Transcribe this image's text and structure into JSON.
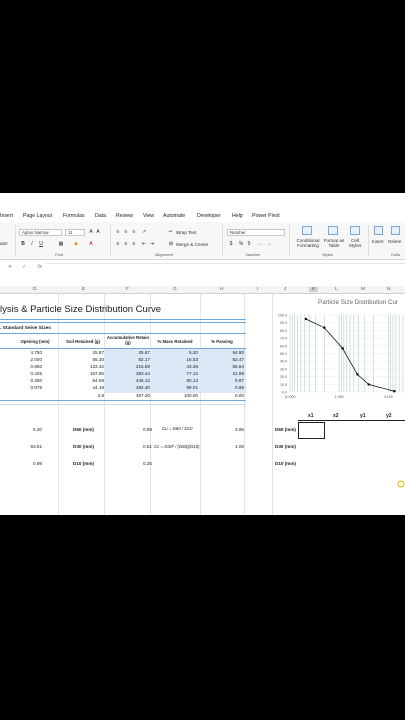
{
  "ribbon": {
    "tabs": [
      "Insert",
      "Page Layout",
      "Formulas",
      "Data",
      "Review",
      "View",
      "Automate",
      "Developer",
      "Help",
      "Power Pivot"
    ],
    "font_name": "Aptos Narrow",
    "font_size": "11",
    "wrap_text": "Wrap Text",
    "merge_center": "Merge & Center",
    "number_format": "Number",
    "conditional_formatting": "Conditional Formatting",
    "format_as_table": "Format as Table",
    "cell_styles": "Cell Styles",
    "insert": "Insert",
    "delete": "Delete",
    "group_font": "Font",
    "group_alignment": "Alignment",
    "group_number": "Number",
    "group_styles": "Styles",
    "group_cells": "Cells",
    "paste_label": "ater"
  },
  "formula_bar": {
    "fx": "fx"
  },
  "columns": [
    "D",
    "E",
    "F",
    "G",
    "H",
    "I",
    "J",
    "K",
    "L",
    "M",
    "N"
  ],
  "sheet": {
    "title": "lysis & Particle Size Distribution Curve",
    "subtitle": ". Standard Seive Sizes",
    "headers": {
      "opening": "Opening (mm)",
      "soil_retained": "Soil Retained (g)",
      "accum_retained": "Accumulative Retain (g)",
      "mass_retained": "% Mass Retained",
      "passing": "% Passing"
    },
    "rows": [
      [
        "4.750",
        "25.87",
        "25.87",
        "5.20",
        "94.80"
      ],
      [
        "2.000",
        "56.30",
        "82.17",
        "16.53",
        "83.47"
      ],
      [
        "0.850",
        "133.42",
        "215.59",
        "43.36",
        "56.64"
      ],
      [
        "0.425",
        "167.85",
        "383.44",
        "77.12",
        "22.88"
      ],
      [
        "0.250",
        "64.68",
        "448.12",
        "90.13",
        "9.87"
      ],
      [
        "0.075",
        "44.19",
        "492.30",
        "99.01",
        "0.99"
      ],
      [
        "",
        "4.9",
        "497.20",
        "100.00",
        "0.00"
      ]
    ],
    "calc": [
      {
        "a": "5.20",
        "label": "D60 (mm)",
        "v": "0.99",
        "formula": "Cu = D60 / D10",
        "result": "3.95",
        "rlabel": "D60 (mm)"
      },
      {
        "a": "93.61",
        "label": "D30 (mm)",
        "v": "0.51",
        "formula": "Cc = D30² / (D60)(D10)",
        "result": "1.06",
        "rlabel": "D30 (mm)"
      },
      {
        "a": "0.99",
        "label": "D10 (mm)",
        "v": "0.25",
        "formula": "",
        "result": "",
        "rlabel": "D10 (mm)"
      }
    ],
    "xy_headers": [
      "x1",
      "x2",
      "y1",
      "y2"
    ]
  },
  "chart_data": {
    "type": "line",
    "title": "Particle Size Distribution Cur",
    "x_scale": "log",
    "x_reversed": true,
    "x_tick_labels": [
      "10.000",
      "1.000",
      "0.100"
    ],
    "y_tick_labels": [
      "0.0",
      "10.0",
      "20.0",
      "30.0",
      "40.0",
      "50.0",
      "60.0",
      "70.0",
      "80.0",
      "90.0",
      "100.0"
    ],
    "ylim": [
      0,
      100
    ],
    "x": [
      4.75,
      2.0,
      0.85,
      0.425,
      0.25,
      0.075
    ],
    "y": [
      94.8,
      83.47,
      56.64,
      22.88,
      9.87,
      0.99
    ],
    "grid": true,
    "line_color": "#000000",
    "gridline_color": "#9fc5c8"
  }
}
